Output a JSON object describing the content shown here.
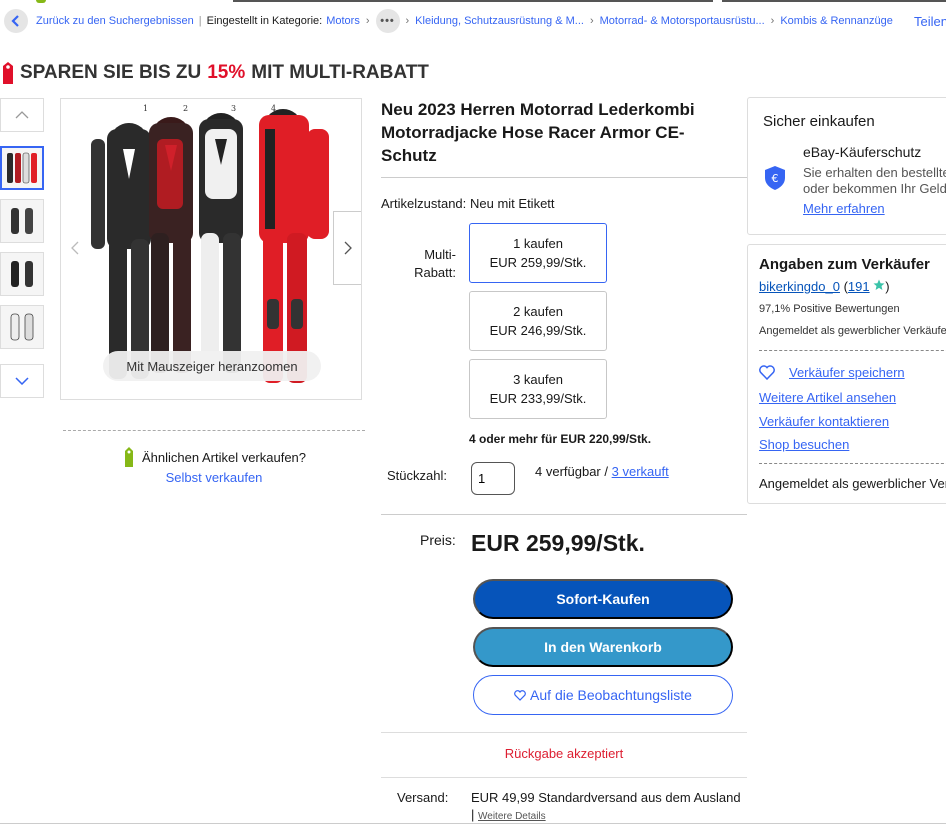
{
  "breadcrumb": {
    "back_label": "Zurück zu den Suchergebnissen",
    "listed_in": "Eingestellt in Kategorie:",
    "items": [
      "Motors",
      "Kleidung, Schutzausrüstung & M...",
      "Motorrad- & Motorsportausrüstu...",
      "Kombis & Rennanzüge"
    ],
    "share": "Teilen"
  },
  "promo": {
    "prefix": "SPAREN SIE BIS ZU",
    "percent": "15%",
    "suffix": "MIT MULTI-RABATT"
  },
  "gallery": {
    "zoom_hint": "Mit Mauszeiger heranzoomen",
    "suit_numbers": [
      "1",
      "2",
      "3",
      "4"
    ],
    "suit_colors": [
      "#2a2a2a",
      "#b01c22",
      "#f0f0f0",
      "#e01e26"
    ]
  },
  "sell_similar": {
    "question": "Ähnlichen Artikel verkaufen?",
    "link": "Selbst verkaufen"
  },
  "item": {
    "title": "Neu 2023 Herren Motorrad Lederkombi Motorradjacke Hose Racer Armor CE-Schutz",
    "condition_label": "Artikelzustand:",
    "condition_value": "Neu mit Etikett",
    "multibuy_label_1": "Multi-",
    "multibuy_label_2": "Rabatt:",
    "tiers": [
      {
        "qty": "1 kaufen",
        "price": "EUR 259,99/Stk."
      },
      {
        "qty": "2 kaufen",
        "price": "EUR 246,99/Stk."
      },
      {
        "qty": "3 kaufen",
        "price": "EUR 233,99/Stk."
      }
    ],
    "tier_more": "4 oder mehr für EUR 220,99/Stk.",
    "quantity_label": "Stückzahl:",
    "quantity_value": "1",
    "available": "4 verfügbar /",
    "sold": "3 verkauft",
    "price_label": "Preis:",
    "price": "EUR 259,99/Stk.",
    "buy_now": "Sofort-Kaufen",
    "add_to_cart": "In den Warenkorb",
    "watchlist": "Auf die Beobachtungsliste",
    "returns": "Rückgabe akzeptiert",
    "shipping_label": "Versand:",
    "shipping_cost": "EUR 49,99",
    "shipping_method": "Standardversand aus dem Ausland",
    "shipping_details": "Weitere Details"
  },
  "buyer_protection": {
    "heading": "Sicher einkaufen",
    "title": "eBay-Käuferschutz",
    "desc_1": "Sie erhalten den bestellten Artikel",
    "desc_2": "oder bekommen Ihr Geld zurück.",
    "link": "Mehr erfahren"
  },
  "seller": {
    "heading": "Angaben zum Verkäufer",
    "name": "bikerkingdo_0",
    "score": "191",
    "feedback": "97,1% Positive Bewertungen",
    "registered_business": "Angemeldet als gewerblicher Verkäufer",
    "save": "Verkäufer speichern",
    "more_items": "Weitere Artikel ansehen",
    "contact": "Verkäufer kontaktieren",
    "shop": "Shop besuchen",
    "registered_business_2": "Angemeldet als gewerblicher Verkäufer"
  },
  "colors": {
    "link": "#3665f3",
    "buy_button": "#0654ba",
    "cart_button": "#3498ca",
    "promo_red": "#e0102a",
    "returns_red": "#dd1e31"
  }
}
